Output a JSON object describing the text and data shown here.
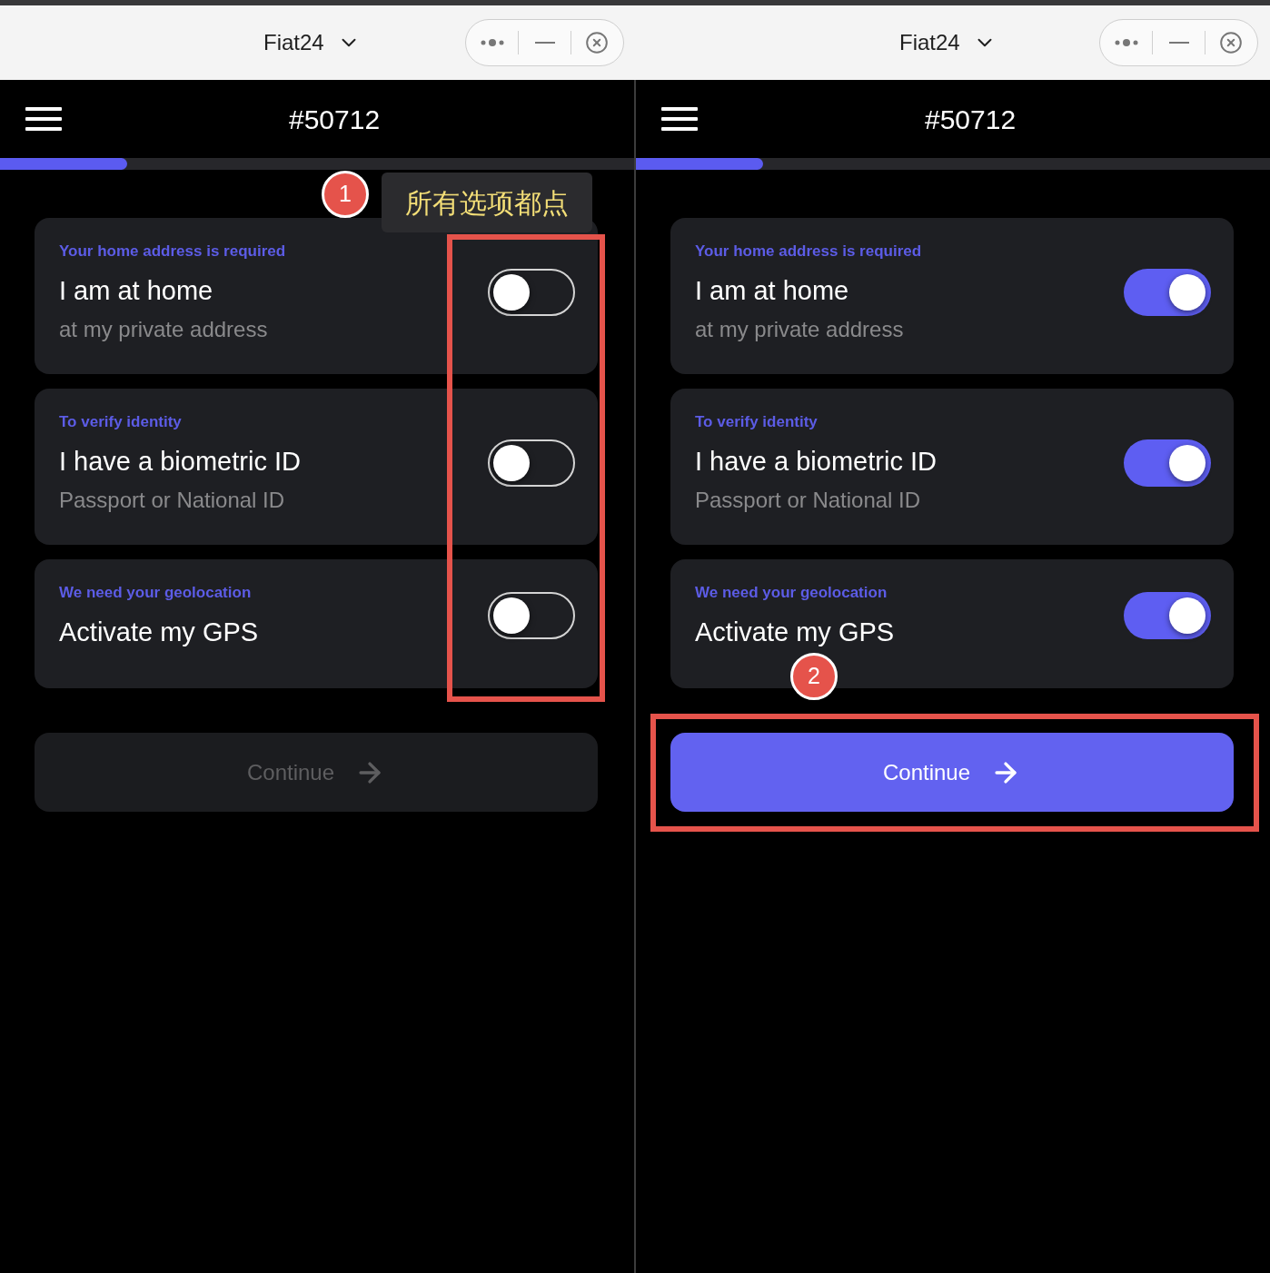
{
  "panels": [
    {
      "app_title": "Fiat24",
      "account_number": "#50712",
      "progress": {
        "level": 0.2
      },
      "options": [
        {
          "caption": "Your home address is required",
          "title": "I am at home",
          "subtitle": "at my private address",
          "on": false
        },
        {
          "caption": "To verify identity",
          "title": "I have a biometric ID",
          "subtitle": "Passport or National ID",
          "on": false
        },
        {
          "caption": "We need your geolocation",
          "title": "Activate my GPS",
          "on": false
        }
      ],
      "continue_button": {
        "label": "Continue",
        "disabled": true
      },
      "annotation": {
        "kind": "toggles",
        "step": "1",
        "note": "所有选项都点"
      }
    },
    {
      "app_title": "Fiat24",
      "account_number": "#50712",
      "progress": {
        "level": 0.2
      },
      "options": [
        {
          "caption": "Your home address is required",
          "title": "I am at home",
          "subtitle": "at my private address",
          "on": true
        },
        {
          "caption": "To verify identity",
          "title": "I have a biometric ID",
          "subtitle": "Passport or National ID",
          "on": true
        },
        {
          "caption": "We need your geolocation",
          "title": "Activate my GPS",
          "on": true
        }
      ],
      "continue_button": {
        "label": "Continue",
        "disabled": false
      },
      "annotation": {
        "kind": "button",
        "step": "2"
      }
    }
  ]
}
